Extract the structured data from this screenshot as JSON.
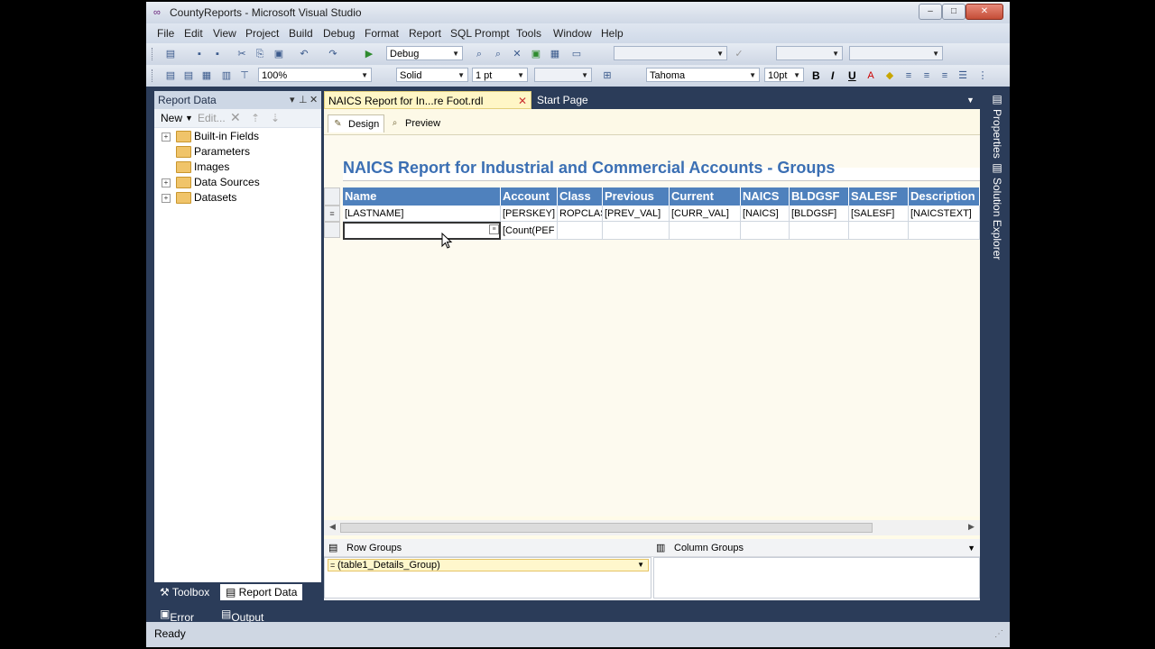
{
  "window": {
    "title": "CountyReports - Microsoft Visual Studio"
  },
  "menu": [
    "File",
    "Edit",
    "View",
    "Project",
    "Build",
    "Debug",
    "Format",
    "Report",
    "SQL Prompt",
    "Tools",
    "Window",
    "Help"
  ],
  "toolbar": {
    "config": "Debug",
    "zoom": "100%",
    "border_style": "Solid",
    "border_width": "1 pt",
    "font": "Tahoma",
    "font_size": "10pt",
    "bold": "B",
    "italic": "I",
    "underline": "U"
  },
  "report_data": {
    "title": "Report Data",
    "new_label": "New",
    "edit_label": "Edit...",
    "items": [
      {
        "label": "Built-in Fields",
        "expandable": true
      },
      {
        "label": "Parameters",
        "expandable": false
      },
      {
        "label": "Images",
        "expandable": false
      },
      {
        "label": "Data Sources",
        "expandable": true
      },
      {
        "label": "Datasets",
        "expandable": true
      }
    ],
    "tabs": {
      "toolbox": "Toolbox",
      "report_data": "Report Data"
    }
  },
  "bottom_windows": {
    "error_list": "Error List",
    "output": "Output"
  },
  "status": "Ready",
  "doc_tabs": {
    "active": "NAICS Report for In...re Foot.rdl [Design]*",
    "start": "Start Page"
  },
  "view_tabs": {
    "design": "Design",
    "preview": "Preview"
  },
  "report": {
    "title": "NAICS Report for Industrial and Commercial Accounts - Groups",
    "headers": [
      "Name",
      "Account",
      "Class",
      "Previous",
      "Current",
      "NAICS",
      "BLDGSF",
      "SALESF",
      "Description"
    ],
    "detail_row": [
      "[LASTNAME]",
      "[PERSKEY]",
      "ROPCLAS",
      "[PREV_VAL]",
      "[CURR_VAL]",
      "[NAICS]",
      "[BLDGSF]",
      "[SALESF]",
      "[NAICSTEXT]"
    ],
    "footer_row": [
      "",
      "[Count(PEF",
      "",
      "",
      "",
      "",
      "",
      "",
      ""
    ]
  },
  "groups": {
    "row_label": "Row Groups",
    "col_label": "Column Groups",
    "row_item": "(table1_Details_Group)"
  },
  "right_sidebar": {
    "properties": "Properties",
    "solution_explorer": "Solution Explorer"
  },
  "colors": {
    "header_blue": "#4f81bd",
    "chrome": "#2b3c59",
    "doc_tab": "#fff6c6"
  }
}
